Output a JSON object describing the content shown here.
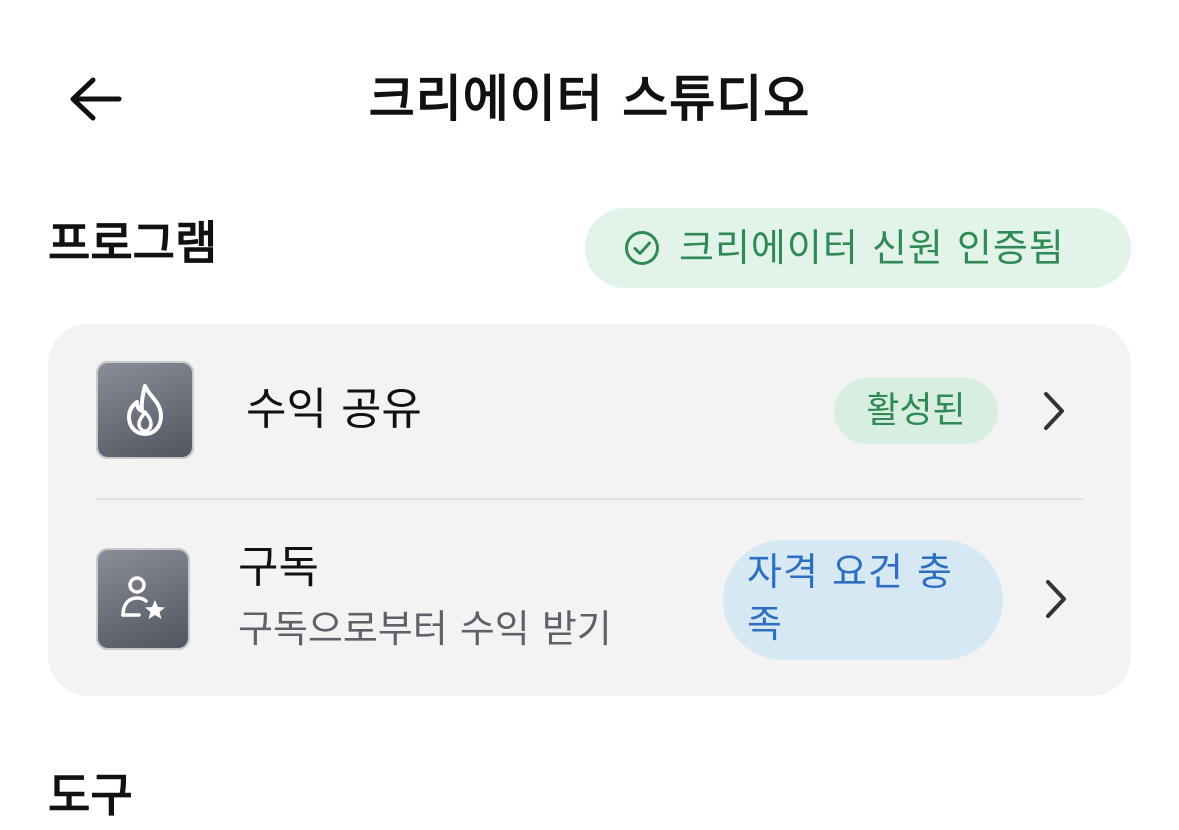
{
  "header": {
    "back_icon": "arrow-left-icon",
    "title": "크리에이터 스튜디오"
  },
  "programs": {
    "section_title": "프로그램",
    "verified_badge": {
      "icon": "check-circle-icon",
      "label": "크리에이터 신원 인증됨",
      "color": "#2f8a55"
    },
    "items": [
      {
        "icon": "flame-icon",
        "title": "수익 공유",
        "status": "활성된",
        "status_color": "#2f8a55",
        "chevron": "chevron-right-icon"
      },
      {
        "icon": "user-star-icon",
        "title": "구독",
        "subtitle": "구독으로부터 수익 받기",
        "status": "자격 요건 충족",
        "status_color": "#2f6fc2",
        "chevron": "chevron-right-icon"
      }
    ]
  },
  "next_section": {
    "title_partial": "도구"
  }
}
